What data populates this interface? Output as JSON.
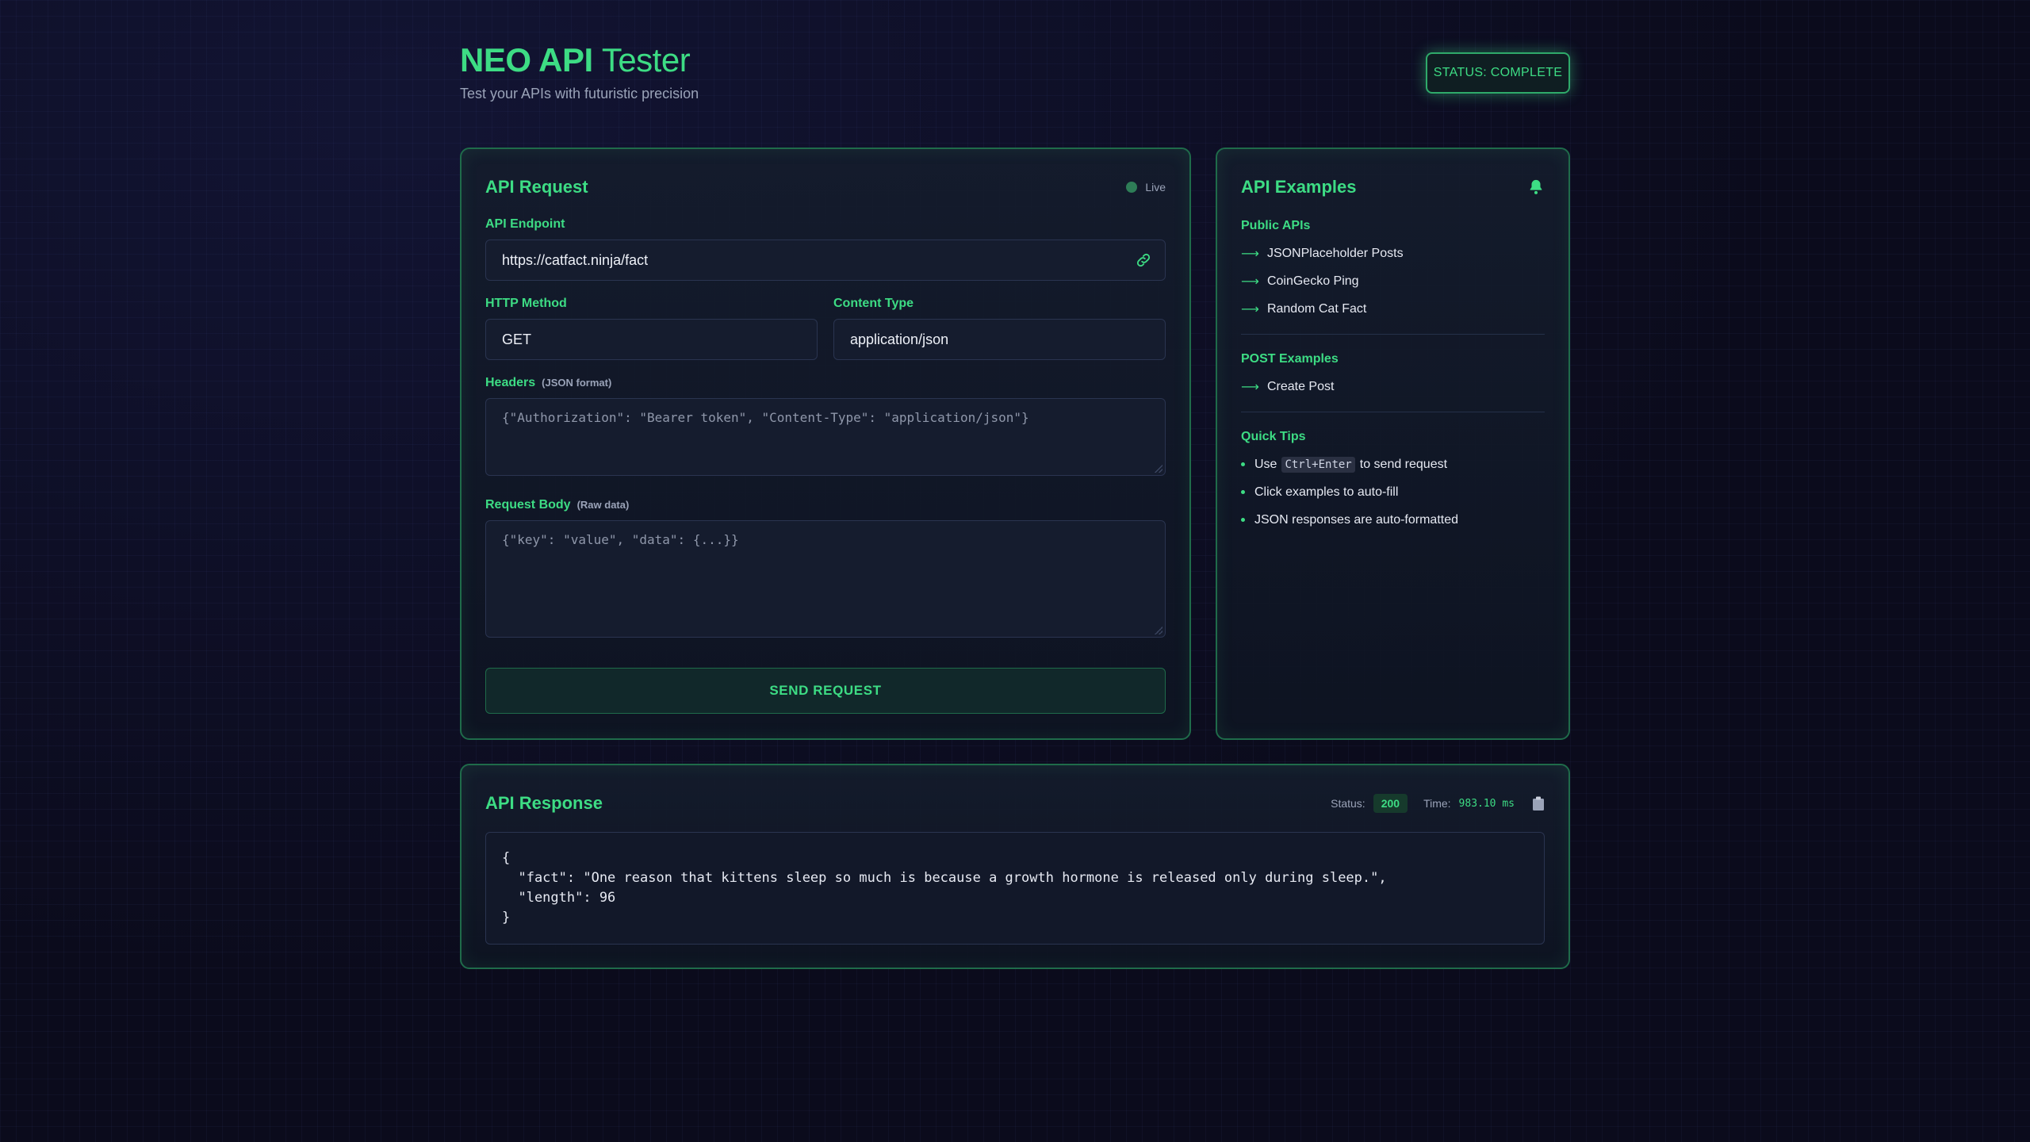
{
  "header": {
    "title_bold": "NEO API",
    "title_thin": "Tester",
    "subtitle": "Test your APIs with futuristic precision",
    "status": "STATUS: COMPLETE"
  },
  "request": {
    "title": "API Request",
    "live_label": "Live",
    "endpoint_label": "API Endpoint",
    "endpoint_value": "https://catfact.ninja/fact",
    "method_label": "HTTP Method",
    "method_value": "GET",
    "content_type_label": "Content Type",
    "content_type_value": "application/json",
    "headers_label": "Headers",
    "headers_hint": "(JSON format)",
    "headers_placeholder": "{\"Authorization\": \"Bearer token\", \"Content-Type\": \"application/json\"}",
    "body_label": "Request Body",
    "body_hint": "(Raw data)",
    "body_placeholder": "{\"key\": \"value\", \"data\": {...}}",
    "send_label": "SEND REQUEST"
  },
  "examples": {
    "title": "API Examples",
    "public_head": "Public APIs",
    "public_items": [
      "JSONPlaceholder Posts",
      "CoinGecko Ping",
      "Random Cat Fact"
    ],
    "post_head": "POST Examples",
    "post_items": [
      "Create Post"
    ],
    "tips_head": "Quick Tips",
    "tips": {
      "tip1_prefix": "Use",
      "tip1_kbd": "Ctrl+Enter",
      "tip1_suffix": "to send request",
      "tip2": "Click examples to auto-fill",
      "tip3": "JSON responses are auto-formatted"
    }
  },
  "response": {
    "title": "API Response",
    "status_label": "Status:",
    "status_code": "200",
    "time_label": "Time:",
    "time_value": "983.10 ms",
    "body": "{\n  \"fact\": \"One reason that kittens sleep so much is because a growth hormone is released only during sleep.\",\n  \"length\": 96\n}"
  },
  "colors": {
    "accent": "#3ddc84",
    "background": "#0b0b1c",
    "panel_border": "#1f6b4a"
  }
}
